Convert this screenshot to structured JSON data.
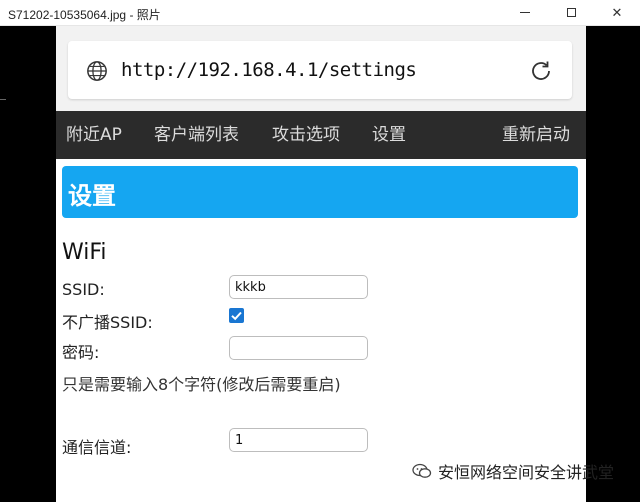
{
  "window": {
    "title": "S71202-10535064.jpg - 照片",
    "minimize_icon": "minimize-icon",
    "maximize_icon": "maximize-icon",
    "close_glyph": "✕"
  },
  "browser": {
    "url": "http://192.168.4.1/settings",
    "globe_icon": "globe-icon",
    "reload_icon": "reload-icon"
  },
  "nav": {
    "items": [
      "附近AP",
      "客户端列表",
      "攻击选项",
      "设置"
    ],
    "restart": "重新启动"
  },
  "page": {
    "header": "设置",
    "section": "WiFi",
    "ssid_label": "SSID:",
    "ssid_value": "kkkb",
    "hide_ssid_label": "不广播SSID:",
    "hide_ssid_checked": true,
    "password_label": "密码:",
    "password_value": "",
    "note": "只是需要输入8个字符(修改后需要重启)",
    "channel_label": "通信信道:",
    "channel_value": "1"
  },
  "watermark": {
    "text": "安恒网络空间安全讲武堂"
  },
  "colors": {
    "banner": "#15a6f1",
    "nav_bg": "#2b2b2b",
    "checkbox": "#1976d2"
  }
}
